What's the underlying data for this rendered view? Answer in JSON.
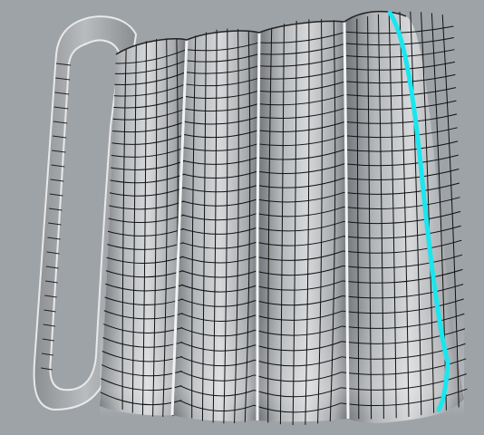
{
  "viewport": {
    "background": "#9ea3a8",
    "display_mode": "shaded-with-isocurves"
  },
  "model": {
    "name": "mug",
    "ribs": 4,
    "handle": true,
    "surface_color": "#c8cacc",
    "isocurve_color": "#111111",
    "seam_color": "#f2f2f2"
  },
  "selection": {
    "highlighted_edge": "right-outer-edge",
    "highlight_color": "#19e6ee"
  }
}
